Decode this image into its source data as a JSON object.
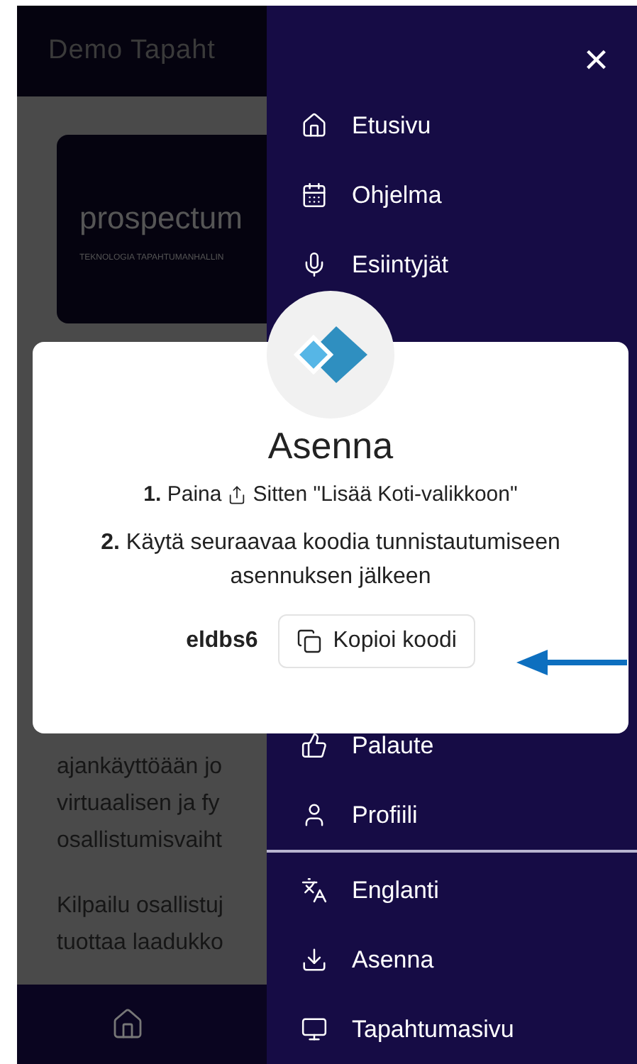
{
  "header": {
    "title": "Demo Tapaht"
  },
  "logo_card": {
    "name": "prospectum",
    "tagline": "TEKNOLOGIA TAPAHTUMANHALLIN"
  },
  "background_text": {
    "paragraphs": [
      [
        "ajankäyttöään jo",
        "virtuaalisen ja fy",
        "osallistumisvaiht"
      ],
      [
        "Kilpailu osallistuj",
        "tuottaa laadukko"
      ]
    ]
  },
  "drawer": {
    "close": "×",
    "top_items": [
      {
        "label": "Etusivu"
      },
      {
        "label": "Ohjelma"
      },
      {
        "label": "Esiintyjät"
      }
    ],
    "bottom_items": [
      {
        "label": "Palaute"
      },
      {
        "label": "Profiili"
      }
    ],
    "footer_items": [
      {
        "label": "Englanti"
      },
      {
        "label": "Asenna"
      },
      {
        "label": "Tapahtumasivu"
      }
    ]
  },
  "dialog": {
    "title": "Asenna",
    "step1_before": "**1.** Paina",
    "step1_after": "Sitten \"Lisää Koti-valikkoon\"",
    "step2": "**2.** Käytä seuraavaa koodia tunnistautumiseen asennuksen jälkeen",
    "code": "eldbs6",
    "copy_button": "Kopioi koodi"
  }
}
